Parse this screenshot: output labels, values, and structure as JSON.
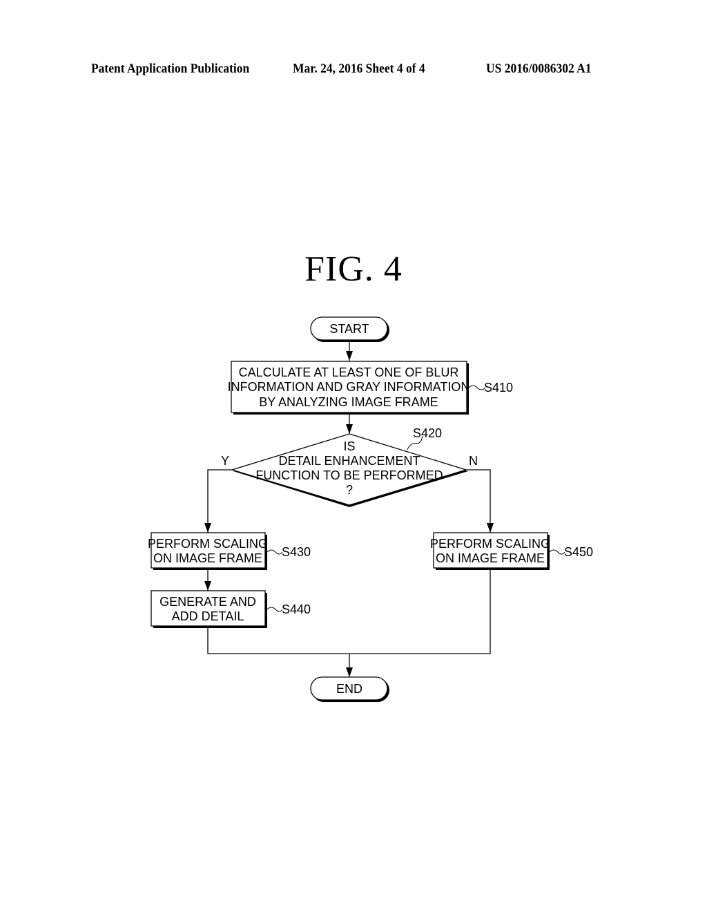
{
  "header": {
    "publication_type": "Patent Application Publication",
    "date_sheet": "Mar. 24, 2016  Sheet 4 of 4",
    "publication_number": "US 2016/0086302 A1"
  },
  "figure": {
    "title": "FIG.  4"
  },
  "flowchart": {
    "start": "START",
    "end": "END",
    "steps": {
      "s410": {
        "ref": "S410",
        "lines": [
          "CALCULATE AT LEAST ONE OF BLUR",
          "INFORMATION AND GRAY INFORMATION",
          "BY ANALYZING IMAGE FRAME"
        ]
      },
      "s420": {
        "ref": "S420",
        "lines": [
          "IS",
          "DETAIL ENHANCEMENT",
          "FUNCTION TO BE PERFORMED",
          "?"
        ],
        "yes_label": "Y",
        "no_label": "N"
      },
      "s430": {
        "ref": "S430",
        "lines": [
          "PERFORM SCALING",
          "ON IMAGE FRAME"
        ]
      },
      "s440": {
        "ref": "S440",
        "lines": [
          "GENERATE AND",
          "ADD DETAIL"
        ]
      },
      "s450": {
        "ref": "S450",
        "lines": [
          "PERFORM SCALING",
          "ON IMAGE FRAME"
        ]
      }
    }
  }
}
